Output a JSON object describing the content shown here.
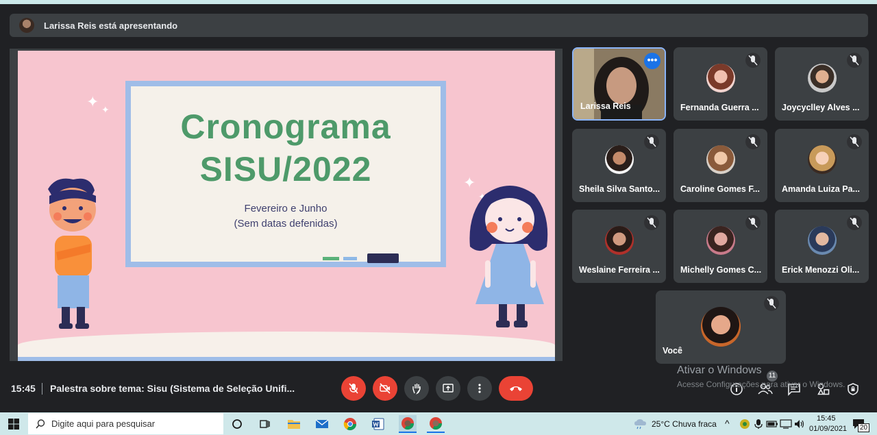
{
  "presenter_banner": "Larissa Reis está apresentando",
  "slide": {
    "title_line1": "Cronograma",
    "title_line2": "SISU/2022",
    "subtitle_line1": "Fevereiro e Junho",
    "subtitle_line2": "(Sem datas defenidas)"
  },
  "participants": [
    {
      "name": "Larissa Reis"
    },
    {
      "name": "Fernanda Guerra ..."
    },
    {
      "name": "Joycyclley Alves ..."
    },
    {
      "name": "Sheila Silva Santo..."
    },
    {
      "name": "Caroline Gomes F..."
    },
    {
      "name": "Amanda Luiza Pa..."
    },
    {
      "name": "Weslaine Ferreira ..."
    },
    {
      "name": "Michelly Gomes C..."
    },
    {
      "name": "Erick Menozzi Oli..."
    },
    {
      "name": "Você"
    }
  ],
  "bottom_bar": {
    "time": "15:45",
    "meeting_title": "Palestra sobre tema: Sisu (Sistema de Seleção Unifi...",
    "people_count": "11"
  },
  "watermark": {
    "title": "Ativar o Windows",
    "subtitle": "Acesse Configurações para ativar o Windows."
  },
  "taskbar": {
    "search_placeholder": "Digite aqui para pesquisar",
    "weather": "25°C  Chuva fraca",
    "clock_time": "15:45",
    "clock_date": "01/09/2021",
    "notification_count": "20"
  },
  "colors": {
    "meet_bg": "#202124",
    "tile_bg": "#3c4043",
    "danger": "#ea4335",
    "active_border": "#8ab4f8",
    "slide_pink": "#f7c5cf",
    "title_green": "#4e9a6a"
  }
}
